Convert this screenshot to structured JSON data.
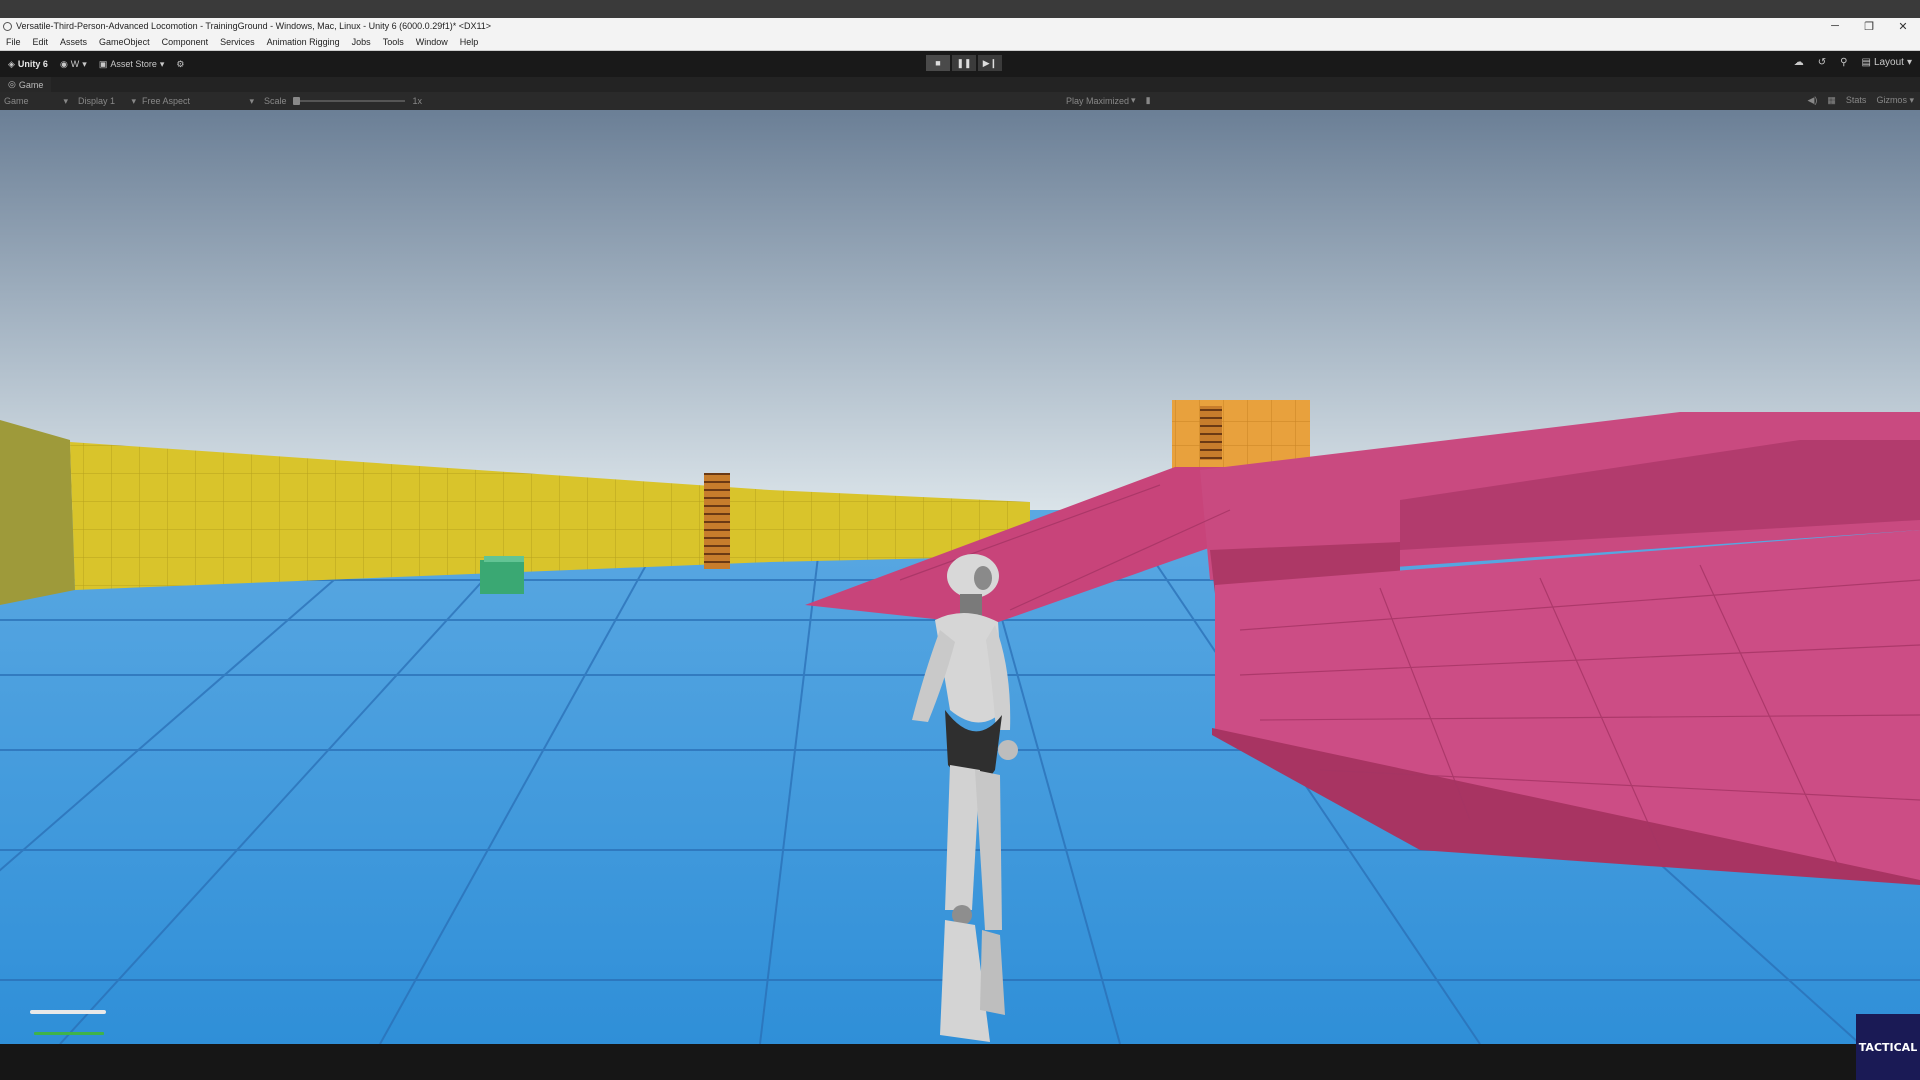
{
  "window": {
    "title": "Versatile-Third-Person-Advanced Locomotion - TrainingGround - Windows, Mac, Linux - Unity 6 (6000.0.29f1)* <DX11>",
    "controls": [
      "─",
      "❐",
      "✕"
    ]
  },
  "menu": [
    "File",
    "Edit",
    "Assets",
    "GameObject",
    "Component",
    "Services",
    "Animation Rigging",
    "Jobs",
    "Tools",
    "Window",
    "Help"
  ],
  "toolbar": {
    "unity_label": "Unity 6",
    "account_label": "W",
    "asset_store_label": "Asset Store",
    "layout_label": "Layout"
  },
  "game_tab": {
    "label": "Game"
  },
  "game_bar": {
    "mode": "Game",
    "display": "Display 1",
    "aspect": "Free Aspect",
    "scale_label": "Scale",
    "scale_value": "1x",
    "play_mode": "Play Maximized",
    "stats": "Stats",
    "gizmos": "Gizmos"
  },
  "logo": {
    "text": "TACTICAL"
  },
  "colors": {
    "sky_top": "#6b7f96",
    "sky_horizon": "#d9e4ea",
    "floor": "#3f9be0",
    "yellow_wall": "#d8c22a",
    "magenta": "#c8447a",
    "orange": "#e59b3a"
  }
}
